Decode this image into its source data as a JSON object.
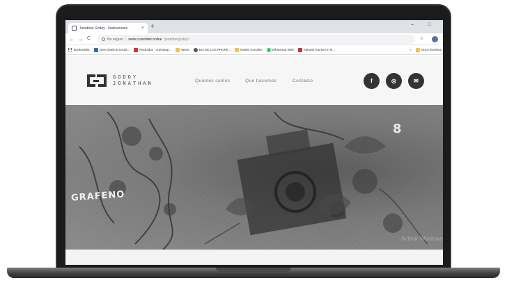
{
  "browser": {
    "tab_title": "Jonathan Godoy - Ilustraciones",
    "tab_close": "×",
    "new_tab": "+",
    "window_controls": [
      "–",
      "□"
    ],
    "back": "←",
    "forward": "→",
    "reload": "C",
    "security_label": "No seguro",
    "url_host": "www.cursolider.online",
    "url_path": "/jonathangodoy/",
    "bookmarks": [
      {
        "label": "Bookmarks",
        "color": "#4285f4"
      },
      {
        "label": "Joes Deals & Social...",
        "color": "#3b66c4"
      },
      {
        "label": "Recibidos - cuentasp...",
        "color": "#d93025"
      },
      {
        "label": "Wena",
        "color": "#f4c542"
      },
      {
        "label": "DIA DE LOS PROFE...",
        "color": "#555555"
      },
      {
        "label": "Redes Sociales",
        "color": "#f4c542"
      },
      {
        "label": "WhatsApp Web",
        "color": "#25d366"
      },
      {
        "label": "Kahuak Tourism in R...",
        "color": "#c0392b"
      }
    ],
    "more_bookmarks": "»",
    "other_bookmarks": "Otros favoritos"
  },
  "site": {
    "logo_line1": "GODOY",
    "logo_line2": "JONATHAN",
    "nav": [
      "Quienes somos",
      "Que hacemos",
      "Contacto"
    ],
    "social": [
      {
        "icon": "facebook-icon",
        "glyph": "f"
      },
      {
        "icon": "instagram-icon",
        "glyph": "◎"
      },
      {
        "icon": "mail-icon",
        "glyph": "✉"
      }
    ],
    "hero_text_left": "GRAFENO",
    "hero_text_right": "8",
    "watermark": "Activar Windows"
  },
  "colors": {
    "accent_dark": "#333333",
    "header_bg": "#f6f6f6",
    "bezel": "#1b1b1d"
  }
}
